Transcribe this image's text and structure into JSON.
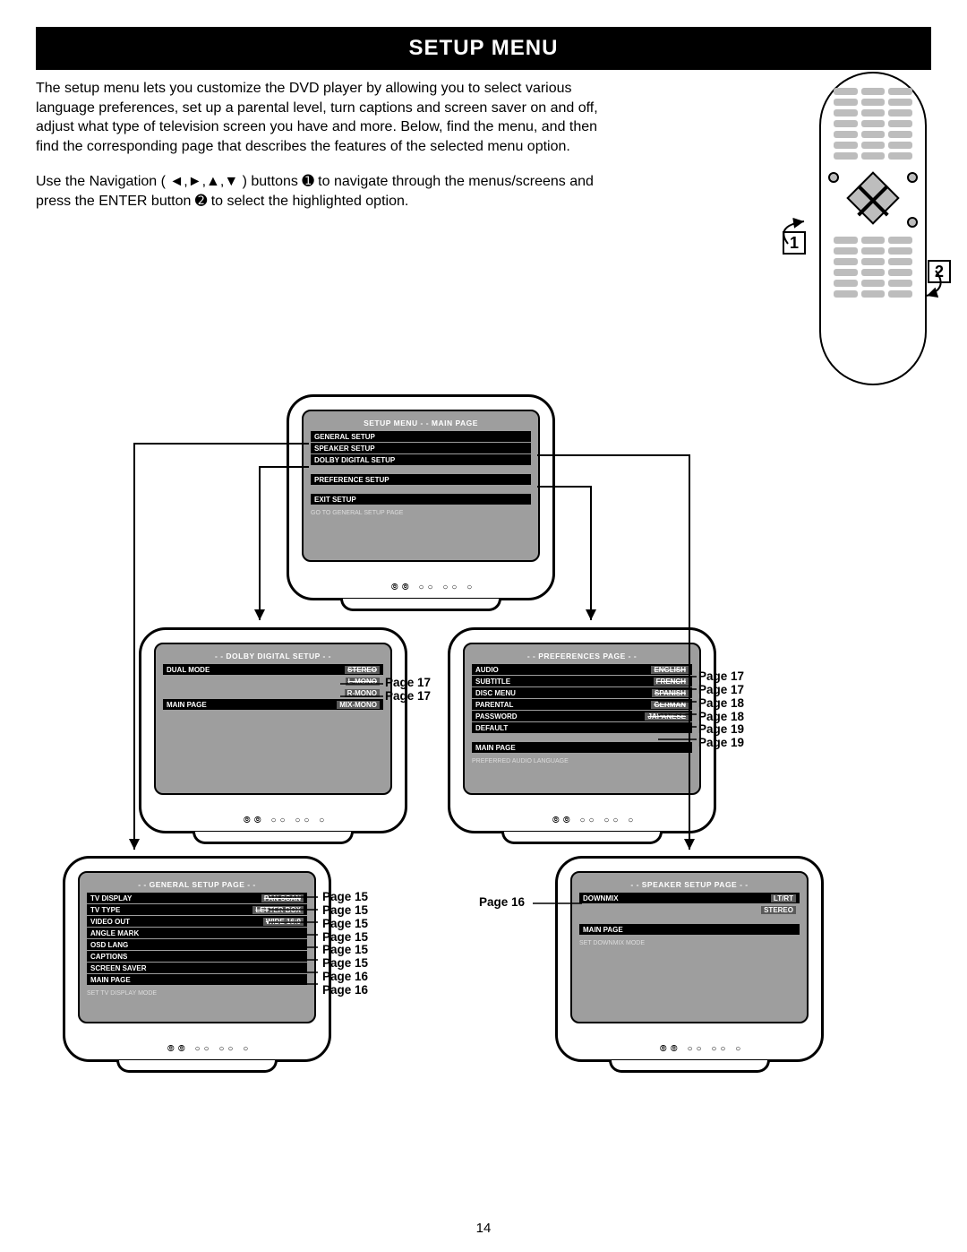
{
  "page_number": "14",
  "title": "SETUP MENU",
  "intro_para": "The setup menu lets you customize the DVD player by allowing you to select various language preferences, set up a parental level, turn captions and screen saver on and off, adjust what type of television screen you have and more. Below, find the menu, and then find the corresponding page that describes the features of the selected menu option.",
  "nav_para_prefix": "Use the Navigation (",
  "nav_para_suffix_1": ") buttons ",
  "nav_para_suffix_2": " to navigate through the menus/screens and press the ENTER button ",
  "nav_para_suffix_3": " to select the highlighted option.",
  "flag1": "1",
  "flag2": "2",
  "screens": {
    "main": {
      "title": "SETUP MENU  - -  MAIN PAGE",
      "items": [
        {
          "l": "GENERAL  SETUP"
        },
        {
          "l": "SPEAKER SETUP"
        },
        {
          "l": "DOLBY DIGITAL SETUP"
        },
        {
          "l": "PREFERENCE SETUP",
          "sp": true
        },
        {
          "l": "EXIT SETUP",
          "sp": true
        }
      ],
      "hint": "GO TO GENERAL SETUP PAGE"
    },
    "dolby": {
      "title": "- -   DOLBY DIGITAL SETUP   - -",
      "items": [
        {
          "l": "DUAL MODE",
          "r": "STEREO",
          "hi": true
        },
        {
          "l": "",
          "r": "L-MONO",
          "hi": true,
          "nobg": true
        },
        {
          "l": "",
          "r": "R-MONO",
          "nobg": true
        },
        {
          "l": "MAIN PAGE",
          "r": "MIX-MONO"
        }
      ]
    },
    "prefs": {
      "title": "- - PREFERENCES PAGE - -",
      "items": [
        {
          "l": "AUDIO",
          "r": "ENGLISH",
          "hi": true
        },
        {
          "l": "SUBTITLE",
          "r": "FRENCH",
          "hi": true
        },
        {
          "l": "DISC MENU",
          "r": "SPANISH",
          "hi": true
        },
        {
          "l": "PARENTAL",
          "r": "GERMAN",
          "hi": true
        },
        {
          "l": "PASSWORD",
          "r": "JAPANESE",
          "hi": true
        },
        {
          "l": "DEFAULT"
        },
        {
          "l": "MAIN PAGE",
          "sp": true
        }
      ],
      "hint": "PREFERRED AUDIO LANGUAGE"
    },
    "general": {
      "title": "- - GENERAL SETUP PAGE - -",
      "items": [
        {
          "l": "TV DISPLAY",
          "r": "PAN SCAN",
          "hi": true
        },
        {
          "l": "TV TYPE",
          "r": "LETTER BOX",
          "hi": true
        },
        {
          "l": "VIDEO OUT",
          "r": "WIDE 16:9",
          "hi": true
        },
        {
          "l": "ANGLE MARK"
        },
        {
          "l": "OSD LANG"
        },
        {
          "l": "CAPTIONS"
        },
        {
          "l": "SCREEN SAVER"
        },
        {
          "l": "MAIN PAGE"
        }
      ],
      "hint": "SET TV DISPLAY MODE"
    },
    "speaker": {
      "title": "- - SPEAKER SETUP PAGE - -",
      "items": [
        {
          "l": "DOWNMIX",
          "r": "LT/RT"
        },
        {
          "l": "",
          "r": "STEREO",
          "nobg": true
        },
        {
          "l": "MAIN PAGE",
          "sp": true
        }
      ],
      "hint": "SET DOWNMIX MODE"
    }
  },
  "callouts": {
    "dolby": [
      "Page 17",
      "Page 17"
    ],
    "prefs": [
      "Page 17",
      "Page 17",
      "Page 18",
      "Page 18",
      "Page 19",
      "Page 19"
    ],
    "general": [
      "Page 15",
      "Page 15",
      "Page 15",
      "Page 15",
      "Page 15",
      "Page 15",
      "Page 16",
      "Page 16"
    ],
    "speaker": [
      "Page 16"
    ]
  }
}
